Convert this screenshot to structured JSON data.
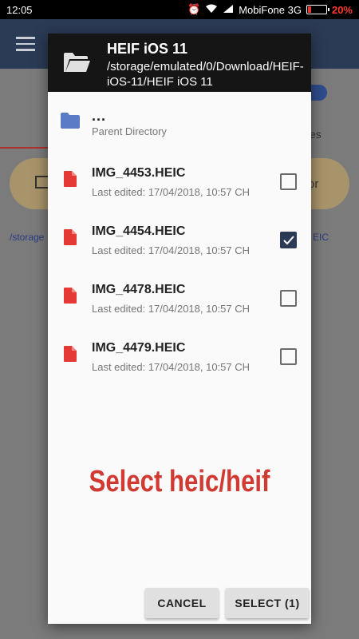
{
  "status_bar": {
    "time": "12:05",
    "carrier": "MobiFone 3G",
    "battery": "20%",
    "battery_level": 0.2
  },
  "background": {
    "tab_fragment": "es",
    "card_fragment": "or",
    "path_fragment": "/storage",
    "path_fragment_right": "EIC"
  },
  "dialog": {
    "title": "HEIF iOS 11",
    "path": "/storage/emulated/0/Download/HEIF-iOS-11/HEIF iOS 11",
    "parent": {
      "name": "...",
      "label": "Parent Directory",
      "icon": "folder-icon"
    },
    "files": [
      {
        "name": "IMG_4453.HEIC",
        "edited": "Last edited: 17/04/2018, 10:57 CH",
        "checked": false
      },
      {
        "name": "IMG_4454.HEIC",
        "edited": "Last edited: 17/04/2018, 10:57 CH",
        "checked": true
      },
      {
        "name": "IMG_4478.HEIC",
        "edited": "Last edited: 17/04/2018, 10:57 CH",
        "checked": false
      },
      {
        "name": "IMG_4479.HEIC",
        "edited": "Last edited: 17/04/2018, 10:57 CH",
        "checked": false
      }
    ],
    "promo": "Select heic/heif",
    "cancel_label": "CANCEL",
    "select_label": "SELECT (1)"
  },
  "colors": {
    "accent": "#2b3a55",
    "file_icon": "#e53935",
    "folder_icon": "#5b7bc7",
    "promo": "#d13a33"
  }
}
